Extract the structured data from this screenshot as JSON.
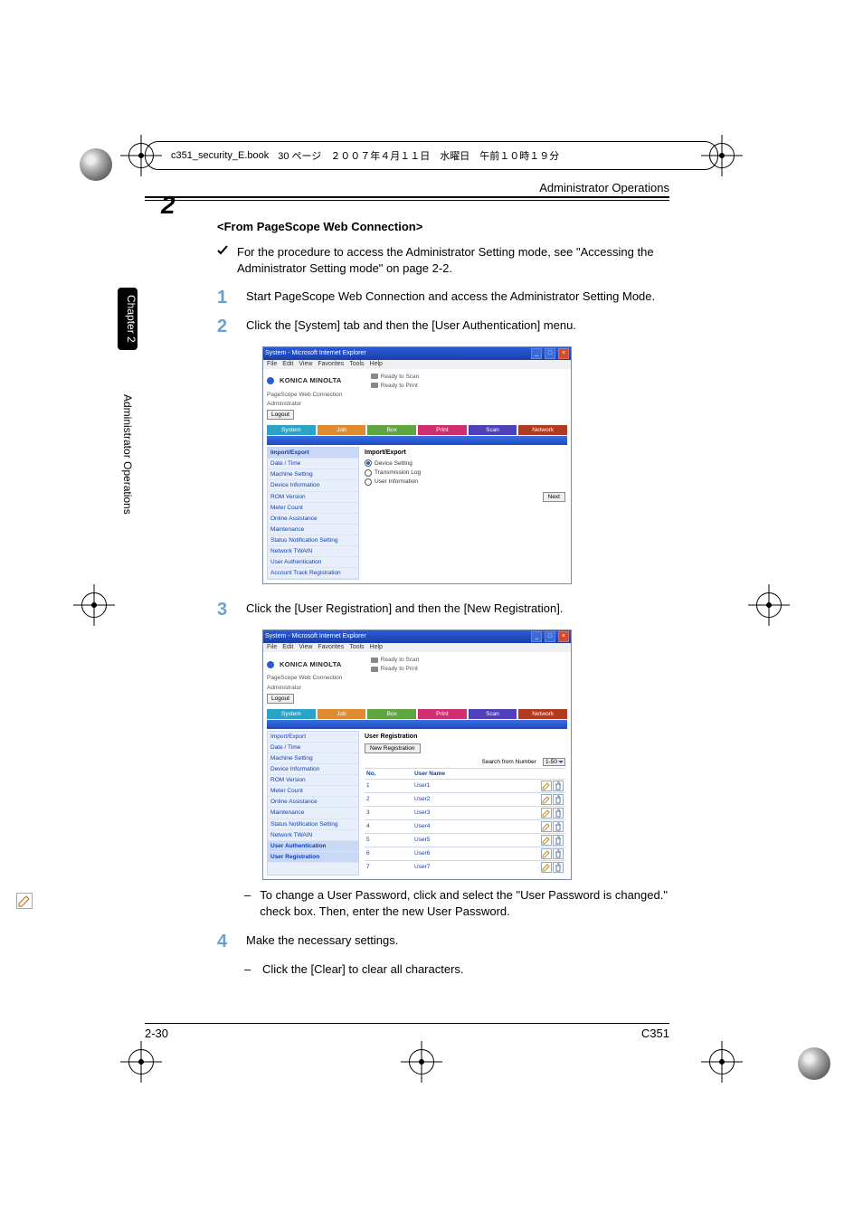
{
  "print_header": {
    "filename": "c351_security_E.book",
    "page": "30 ページ",
    "date": "２００７年４月１１日　水曜日　午前１０時１９分"
  },
  "running_head": "Administrator Operations",
  "chapter_number": "2",
  "side_tab_label": "Chapter 2",
  "side_text_label": "Administrator Operations",
  "subhead": "<From PageScope Web Connection>",
  "check_text": "For the procedure to access the Administrator Setting mode, see \"Accessing the Administrator Setting mode\" on page 2-2.",
  "steps": {
    "s1": "Start PageScope Web Connection and access the Administrator Setting Mode.",
    "s2": "Click the [System] tab and then the [User Authentication] menu.",
    "s3": "Click the [User Registration] and then the [New Registration].",
    "s3_sub": "To change a User Password, click         and select the \"User Password is changed.\" check box. Then, enter the new User Password.",
    "s4": "Make the necessary settings.",
    "s4_sub": "Click the [Clear] to clear all characters."
  },
  "browser": {
    "title": "System - Microsoft Internet Explorer",
    "menus": [
      "File",
      "Edit",
      "View",
      "Favorites",
      "Tools",
      "Help"
    ],
    "brand": "KONICA MINOLTA",
    "sub_brand": "PageScope Web Connection",
    "role": "Administrator",
    "status_scan": "Ready to Scan",
    "status_print": "Ready to Print",
    "logout": "Logout",
    "tabs": [
      "System",
      "Job",
      "Box",
      "Print",
      "Scan",
      "Network"
    ]
  },
  "shot1": {
    "nav": [
      "Import/Export",
      "Date / Time",
      "Machine Setting",
      "Device Information",
      "ROM Version",
      "Meter Count",
      "Online Assistance",
      "Maintenance",
      "Status Notification Setting",
      "Network TWAIN",
      "User Authentication",
      "Account Track Registration"
    ],
    "section_title": "Import/Export",
    "radios": [
      "Device Setting",
      "Transmission Log",
      "User Information"
    ],
    "next": "Next"
  },
  "shot2": {
    "nav": [
      "Import/Export",
      "Date / Time",
      "Machine Setting",
      "Device Information",
      "ROM Version",
      "Meter Count",
      "Online Assistance",
      "Maintenance",
      "Status Notification Setting",
      "Network TWAIN",
      "User Authentication",
      "User Registration"
    ],
    "section_title": "User Registration",
    "new_registration": "New Registration",
    "search_label": "Search from Number",
    "range": "1-50",
    "columns": [
      "No.",
      "User Name"
    ],
    "rows": [
      {
        "no": "1",
        "name": "User1"
      },
      {
        "no": "2",
        "name": "User2"
      },
      {
        "no": "3",
        "name": "User3"
      },
      {
        "no": "4",
        "name": "User4"
      },
      {
        "no": "5",
        "name": "User5"
      },
      {
        "no": "6",
        "name": "User6"
      },
      {
        "no": "7",
        "name": "User7"
      }
    ]
  },
  "footer": {
    "page": "2-30",
    "model": "C351"
  }
}
